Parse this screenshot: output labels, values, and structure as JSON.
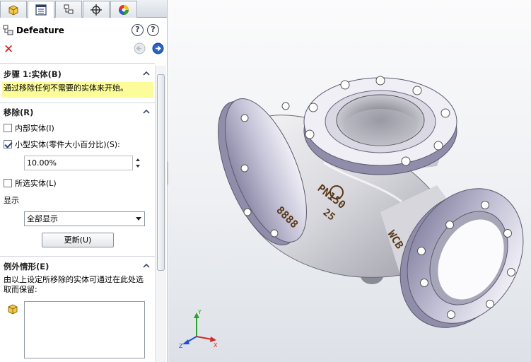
{
  "tabs": [
    {
      "name": "feature-manager",
      "icon": "cube-icon"
    },
    {
      "name": "property-manager",
      "icon": "list-icon"
    },
    {
      "name": "configuration-manager",
      "icon": "config-icon"
    },
    {
      "name": "dimxpert-manager",
      "icon": "crosshair-icon"
    },
    {
      "name": "display-manager",
      "icon": "color-wheel-icon"
    }
  ],
  "header": {
    "title": "Defeature",
    "icons": [
      "defeature-icon",
      "help-whatsnew-icon",
      "help-icon",
      "cancel-icon",
      "back-icon",
      "next-icon"
    ]
  },
  "step1": {
    "heading": "步骤 1:实体(B)",
    "hint": "通过移除任何不需要的实体来开始。"
  },
  "remove": {
    "heading": "移除(R)",
    "internal_bodies": {
      "label": "内部实体(I)",
      "checked": false
    },
    "small_bodies": {
      "label": "小型实体(零件大小百分比)(S):",
      "checked": true
    },
    "percent_value": "10.00%",
    "selected_bodies": {
      "label": "所选实体(L)",
      "checked": false
    },
    "display_label": "显示",
    "display_select": "全部显示",
    "update_button": "更新(U)"
  },
  "exceptions": {
    "heading": "例外情形(E)",
    "description": "由以上设定所移除的实体可通过在此处选取而保留:"
  },
  "model": {
    "text_left": "8888",
    "text_mid1": "PN150",
    "text_mid2": "25",
    "text_right": "WCB",
    "flange_color": "#b9b7cf",
    "body_color": "#dcdce2"
  },
  "triad": {
    "x": "X",
    "y": "Y",
    "z": "Z"
  }
}
